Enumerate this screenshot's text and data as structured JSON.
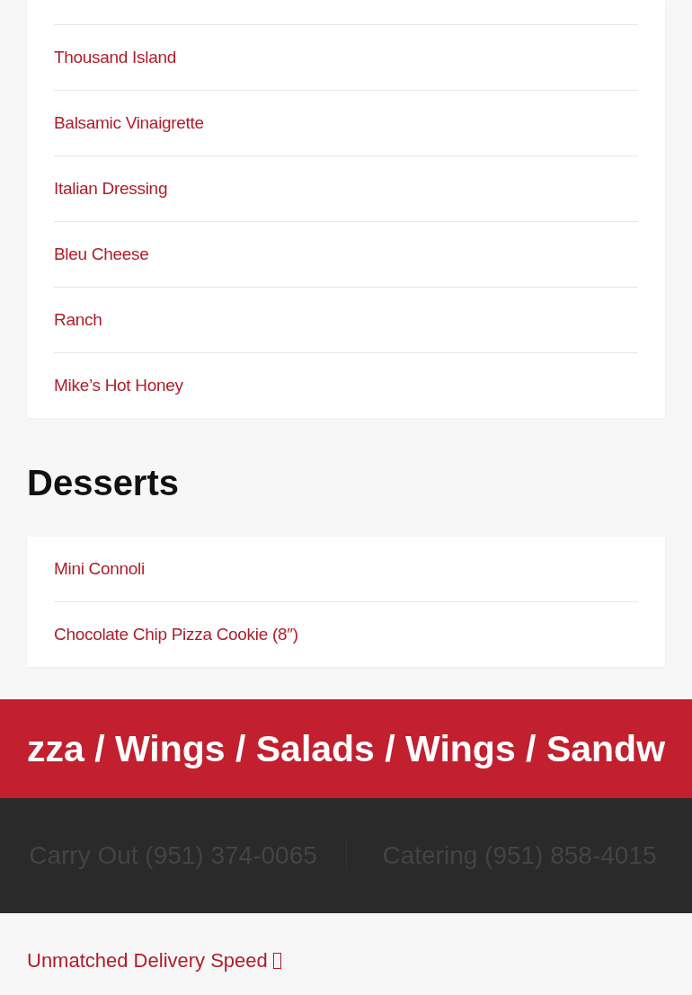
{
  "sections": [
    {
      "items": [
        "Thousand Island",
        "Balsamic Vinaigrette",
        "Italian Dressing",
        "Bleu Cheese",
        "Ranch",
        "Mike’s Hot Honey"
      ]
    },
    {
      "title": "Desserts",
      "items": [
        "Mini Connoli",
        "Chocolate Chip Pizza Cookie (8″)"
      ]
    }
  ],
  "banner": "zza / Wings / Salads / Wings / Sandw",
  "contacts": [
    "Carry Out (951) 374-0065",
    "Catering (951) 858-4015"
  ],
  "feature": "Unmatched Delivery Speed"
}
